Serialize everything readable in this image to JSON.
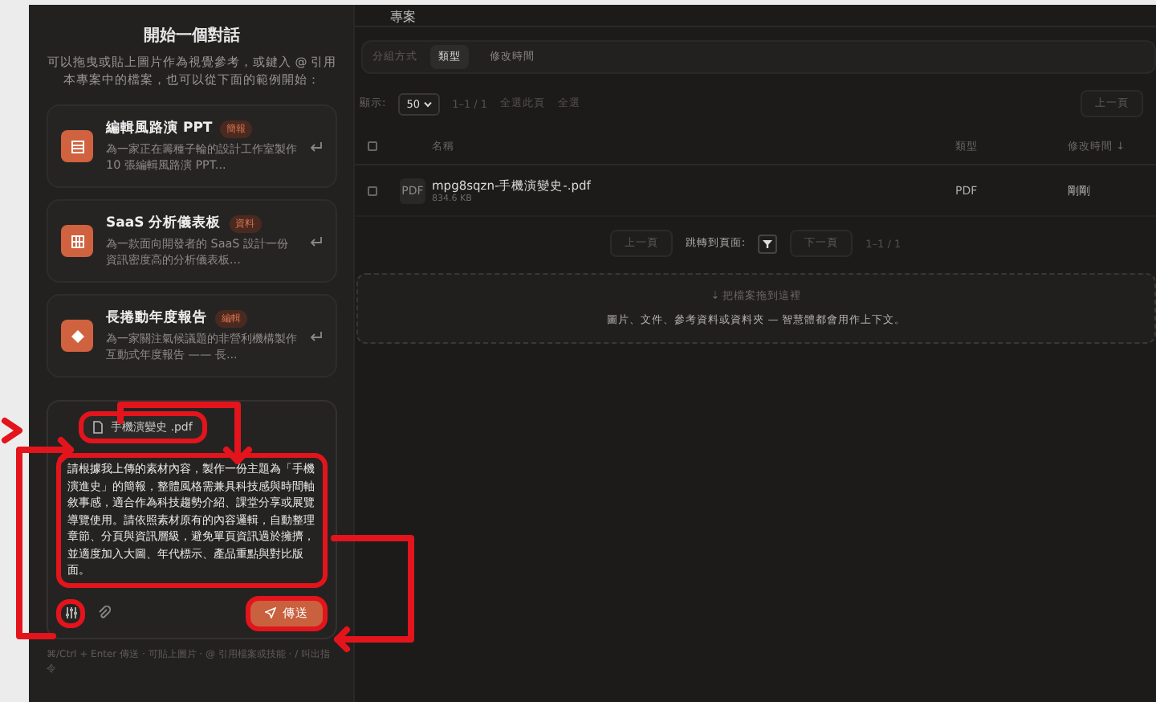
{
  "sidebar": {
    "title": "開始一個對話",
    "subtitle": "可以拖曳或貼上圖片作為視覺參考，或鍵入 @ 引用本專案中的檔案，也可以從下面的範例開始：",
    "examples": [
      {
        "title": "編輯風路演 PPT",
        "tag": "簡報",
        "description": "為一家正在籌種子輪的設計工作室製作 10 張編輯風路演 PPT...",
        "kind": "slides"
      },
      {
        "title": "SaaS 分析儀表板",
        "tag": "資料",
        "description": "為一款面向開發者的 SaaS 設計一份資訊密度高的分析儀表板...",
        "kind": "grid"
      },
      {
        "title": "長捲動年度報告",
        "tag": "編輯",
        "description": "為一家關注氣候議題的非營利機構製作互動式年度報告 —— 長...",
        "kind": "diamond"
      }
    ],
    "composer": {
      "attachment": {
        "name": "手機演變史 .pdf",
        "annotated": true
      },
      "value": "請根據我上傳的素材內容，製作一份主題為「手機演進史」的簡報，整體風格需兼具科技感與時間軸敘事感，適合作為科技趨勢介紹、課堂分享或展覽導覽使用。請依照素材原有的內容邏輯，自動整理章節、分頁與資訊層級，避免單頁資訊過於擁擠，並適度加入大圖、年代標示、產品重點與對比版面。",
      "value_annotated": true,
      "tools_annotated": true,
      "send": {
        "label": "傳送",
        "annotated": true
      },
      "hint": "⌘/Ctrl + Enter 傳送 · 可貼上圖片 · @ 引用檔案或技能 · / 叫出指令"
    }
  },
  "header": {
    "title": "專案"
  },
  "grouping": {
    "label": "分組方式",
    "options": [
      {
        "label": "類型",
        "selected": true
      },
      {
        "label": "修改時間",
        "selected": false
      }
    ]
  },
  "toolbar": {
    "show_label": "顯示:",
    "page_size": "50",
    "range": "1–1 / 1",
    "select_page": "全選此頁",
    "select_all": "全選",
    "prev": "上一頁"
  },
  "table": {
    "all_checked": false,
    "columns": [
      "名稱",
      "類型",
      "修改時間 ↓"
    ],
    "rows": [
      {
        "thumb": "PDF",
        "name": "mpg8sqzn-手機演變史-.pdf",
        "size": "834.6 KB",
        "type": "PDF",
        "modified": "剛剛",
        "checked": false
      }
    ]
  },
  "pagination": {
    "prev": "上一頁",
    "jump_label": "跳轉到頁面:",
    "next": "下一頁",
    "range": "1–1 / 1"
  },
  "dropzone": {
    "title": "⇣ 把檔案拖到這裡",
    "text": "圖片、文件、參考資料或資料夾 — 智慧體都會用作上下文。"
  }
}
